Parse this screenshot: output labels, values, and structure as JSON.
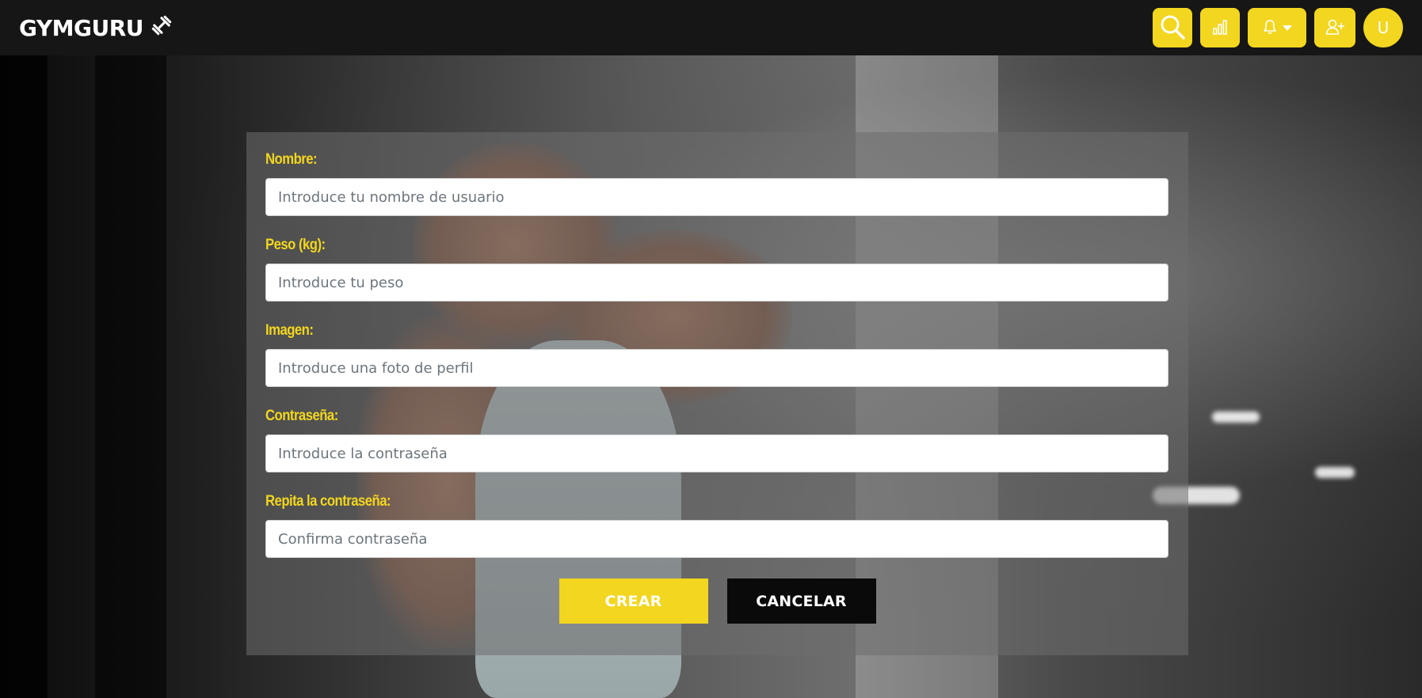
{
  "brand": {
    "name": "GYMGURU",
    "icon": "dumbbell-icon"
  },
  "nav": {
    "search_icon": "search-icon",
    "stats_icon": "bar-chart-icon",
    "bell_icon": "bell-icon",
    "dropdown_icon": "caret-down-icon",
    "add_user_icon": "user-plus-icon",
    "avatar_letter": "U"
  },
  "colors": {
    "accent": "#f2d61f",
    "navbar": "#161616",
    "dark_button": "#0a0a0a"
  },
  "form": {
    "fields": [
      {
        "label": "Nombre:",
        "placeholder": "Introduce tu nombre de usuario",
        "value": ""
      },
      {
        "label": "Peso (kg):",
        "placeholder": "Introduce tu peso",
        "value": ""
      },
      {
        "label": "Imagen:",
        "placeholder": "Introduce una foto de perfil",
        "value": ""
      },
      {
        "label": "Contraseña:",
        "placeholder": "Introduce la contraseña",
        "value": ""
      },
      {
        "label": "Repita la contraseña:",
        "placeholder": "Confirma contraseña",
        "value": ""
      }
    ],
    "submit_label": "CREAR",
    "cancel_label": "CANCELAR"
  }
}
